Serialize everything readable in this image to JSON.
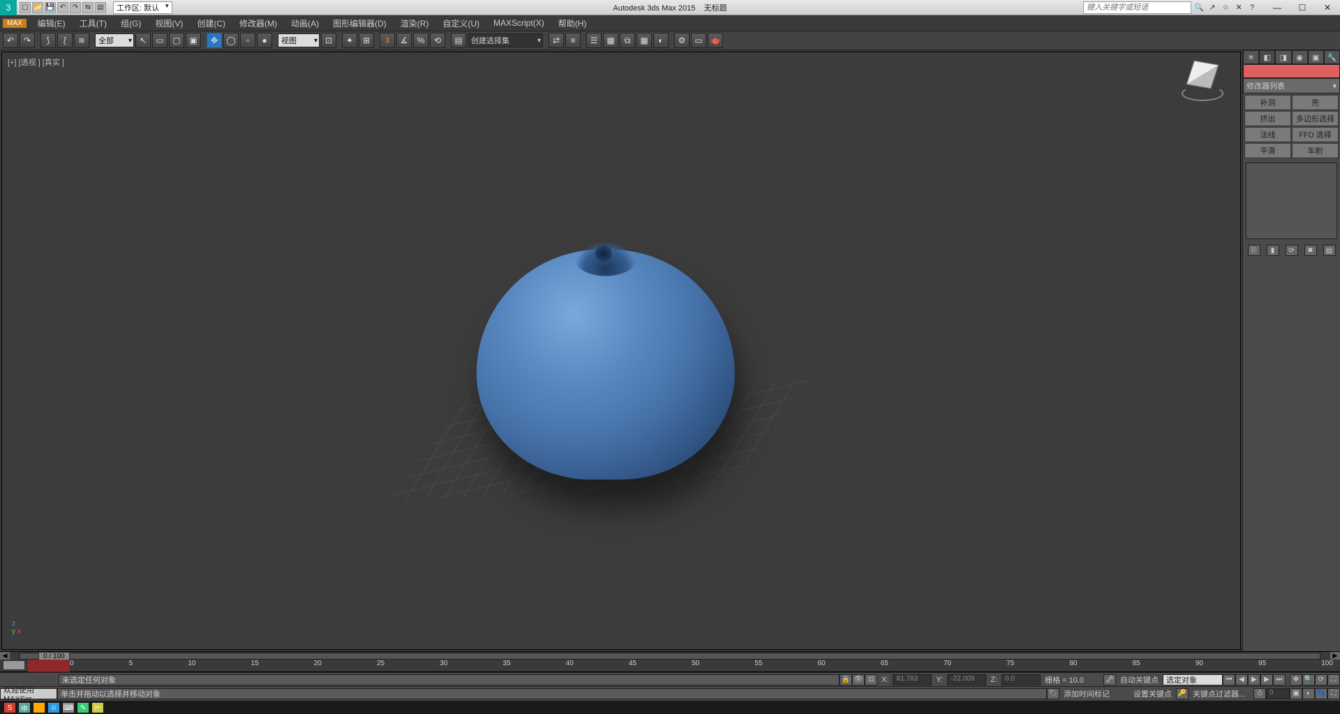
{
  "title_app": "Autodesk 3ds Max  2015",
  "title_doc": "无标题",
  "workspace_label": "工作区: 默认",
  "search_placeholder": "键入关键字或短语",
  "menu": [
    "编辑(E)",
    "工具(T)",
    "组(G)",
    "视图(V)",
    "创建(C)",
    "修改器(M)",
    "动画(A)",
    "图形编辑器(D)",
    "渲染(R)",
    "自定义(U)",
    "MAXScript(X)",
    "帮助(H)"
  ],
  "max_button": "MAX",
  "toolbar_filter": "全部",
  "toolbar_view": "视图",
  "toolbar_selset": "创建选择集",
  "viewport_label": "[+] [透视 ] [真实 ]",
  "timeline": {
    "pos": "0 / 100",
    "ticks": [
      "0",
      "5",
      "10",
      "15",
      "20",
      "25",
      "30",
      "35",
      "40",
      "45",
      "50",
      "55",
      "60",
      "65",
      "70",
      "75",
      "80",
      "85",
      "90",
      "95",
      "100"
    ]
  },
  "status": {
    "welcome": "欢迎使用  MAXScr",
    "sel": "未选定任何对象",
    "prompt": "单击并拖动以选择并移动对象",
    "x": "81.783",
    "y": "-22.009",
    "z": "0.0",
    "grid": "栅格 = 10.0",
    "add_marker": "添加时间标记",
    "auto_key": "自动关键点",
    "set_key": "设置关键点",
    "sel_obj": "选定对象",
    "key_filter": "关键点过滤器..."
  },
  "panel": {
    "mod_list": "修改器列表",
    "items": [
      "补洞",
      "壳",
      "挤出",
      "多边形选择",
      "法线",
      "FFD 选择",
      "平滑",
      "车削"
    ]
  }
}
